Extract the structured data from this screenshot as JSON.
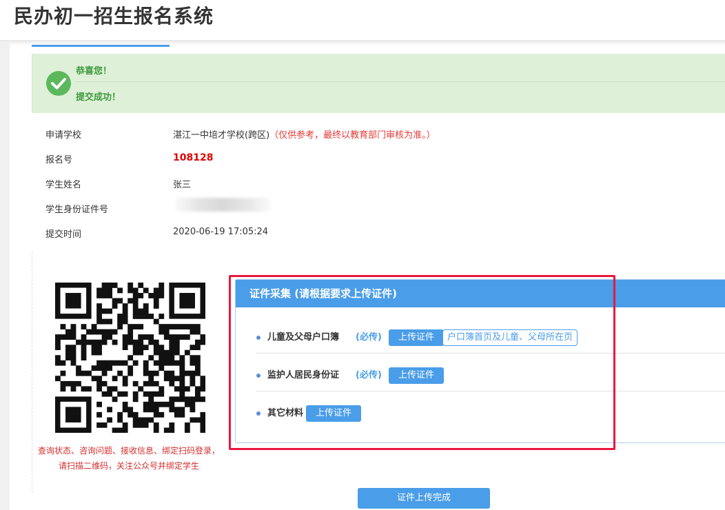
{
  "header": {
    "title": "民办初一招生报名系统"
  },
  "success": {
    "title": "恭喜您！",
    "message": "提交成功！"
  },
  "info": [
    {
      "label": "申请学校",
      "value": "湛江一中培才学校(跨区)",
      "note": "（仅供参考，最终以教育部门审核为准。）"
    },
    {
      "label": "报名号",
      "value": "108128"
    },
    {
      "label": "学生姓名",
      "value": "张三"
    },
    {
      "label": "学生身份证件号",
      "value": ""
    },
    {
      "label": "提交时间",
      "value": "2020-06-19 17:05:24"
    }
  ],
  "qr": {
    "caption": "查询状态、咨询问题、接收信息、绑定扫码登录，请扫描二维码，关注公众号并绑定学生"
  },
  "cert": {
    "header": "证件采集 (请根据要求上传证件)",
    "items": [
      {
        "label": "儿童及父母户口簿",
        "required": "(必传)",
        "button": "上传证件",
        "hint": "户口簿首页及儿童、父母所在页"
      },
      {
        "label": "监护人居民身份证",
        "required": "(必传)",
        "button": "上传证件"
      },
      {
        "label": "其它材料",
        "button": "上传证件"
      }
    ]
  },
  "footer": {
    "done_button": "证件上传完成"
  },
  "colors": {
    "accent": "#4a9de8",
    "success_bg": "#dff0d8",
    "success_text": "#3c9a3c",
    "alert_red": "#e00000",
    "highlight_frame": "#e8183d"
  }
}
